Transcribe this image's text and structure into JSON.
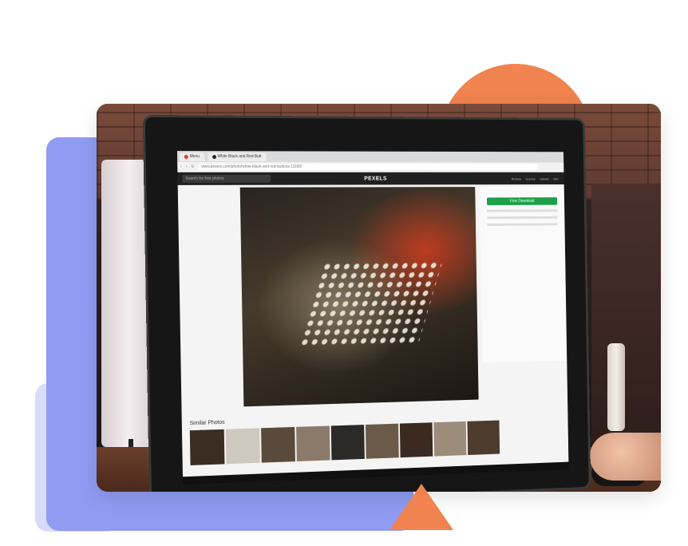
{
  "browser": {
    "tabs": [
      {
        "label": "Menu"
      },
      {
        "label": "White Black and Red Butt"
      }
    ],
    "url": "www.pexels.com/photo/white-black-and-red-buttons-11180/"
  },
  "site": {
    "logo": "PEXELS",
    "search_placeholder": "Search for free photos",
    "nav": [
      "Browse",
      "License",
      "Upload",
      "Join"
    ],
    "download_label": "Free Download",
    "similar_heading": "Similar Photos"
  },
  "colors": {
    "blue_shape": "#8f9cf2",
    "orange_shape": "#f0834f",
    "download_green": "#1da04b"
  }
}
